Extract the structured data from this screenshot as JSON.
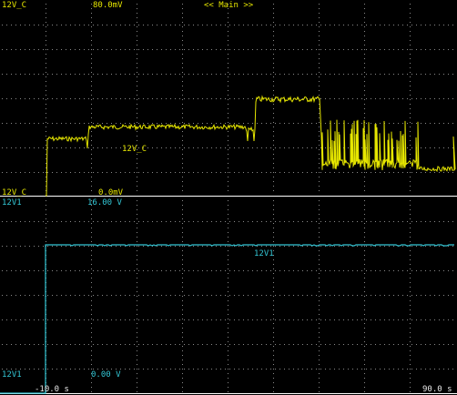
{
  "colors": {
    "background": "#000000",
    "grid": "#8a8a8a",
    "divider": "#ffffff",
    "trace_yellow": "#e6e600",
    "trace_cyan": "#33c7d6",
    "label_white": "#e8e8e8"
  },
  "top_panel": {
    "channel_name_top": "12V_C",
    "top_value": "80.0mV",
    "view_title": "<< Main >>",
    "trace_label": "12V_C",
    "channel_name_bottom": "12V_C",
    "bottom_value": "0.0mV"
  },
  "bottom_panel": {
    "channel_name_top": "12V1",
    "top_value": "16.00 V",
    "trace_label": "12V1",
    "channel_name_bottom": "12V1",
    "bottom_value": "0.00 V"
  },
  "time_axis": {
    "start": "-10.0 s",
    "end": "90.0 s"
  }
}
